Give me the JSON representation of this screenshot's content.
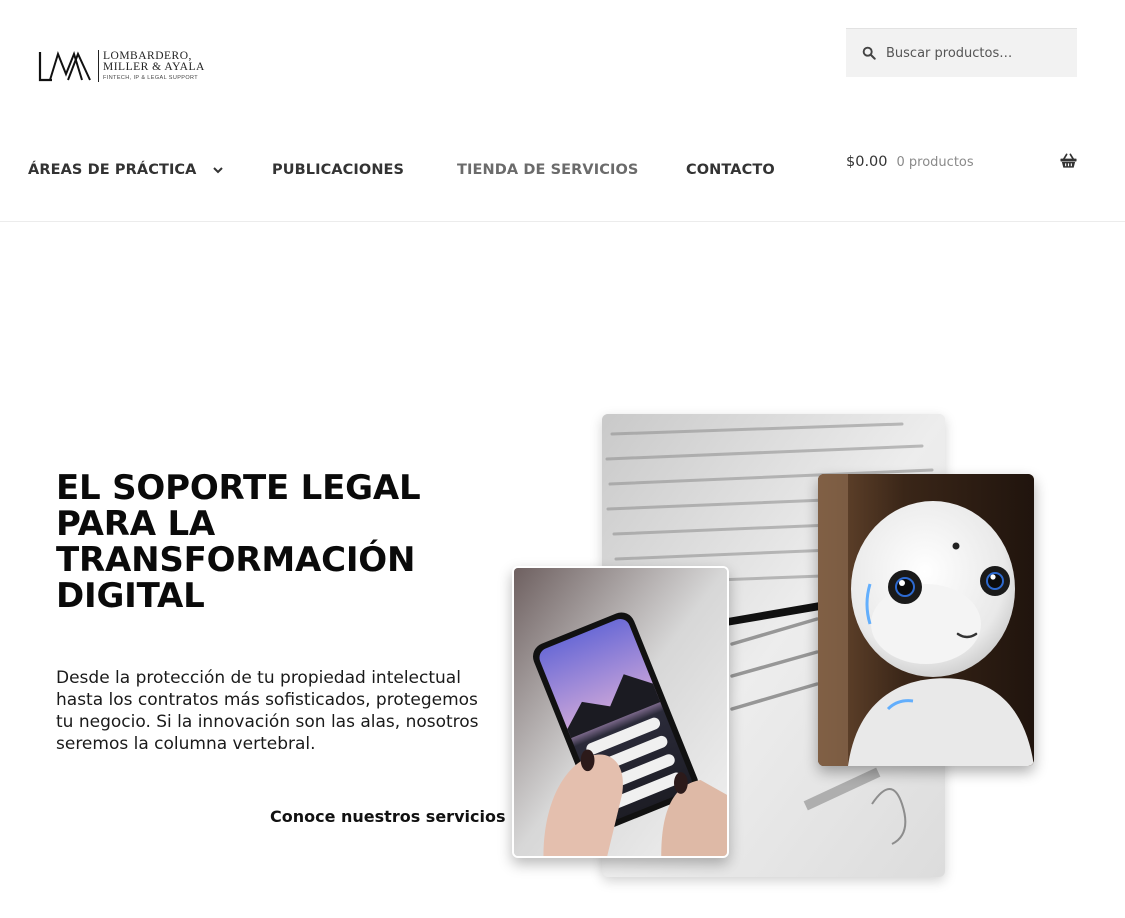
{
  "header": {
    "logo": {
      "mark": "LMA",
      "line1": "LOMBARDERO,",
      "line2": "MILLER & AYALA",
      "line3": "FINTECH, IP & LEGAL SUPPORT"
    },
    "search": {
      "placeholder": "Buscar productos…",
      "icon": "search-icon"
    },
    "nav": [
      {
        "label": "ÁREAS DE PRÁCTICA",
        "has_dropdown": true,
        "active": false
      },
      {
        "label": "PUBLICACIONES",
        "active": false
      },
      {
        "label": "TIENDA DE SERVICIOS",
        "active": true
      },
      {
        "label": "CONTACTO",
        "active": false
      }
    ],
    "cart": {
      "amount": "$0.00",
      "count": "0 productos",
      "icon": "basket-icon"
    }
  },
  "hero": {
    "title_lines": [
      "EL SOPORTE LEGAL",
      "PARA LA",
      "TRANSFORMACIÓN",
      "DIGITAL"
    ],
    "text": "Desde la protección de tu propiedad intelectual hasta los contratos más sofisticados, protegemos tu negocio. Si la innovación son las alas, nosotros seremos la columna vertebral.",
    "cta": "Conoce nuestros servicios"
  },
  "colors": {
    "heading": "#0a0a0a",
    "nav_text": "#333333",
    "nav_active": "#6b6b6b",
    "search_bg": "#f2f2f2"
  }
}
